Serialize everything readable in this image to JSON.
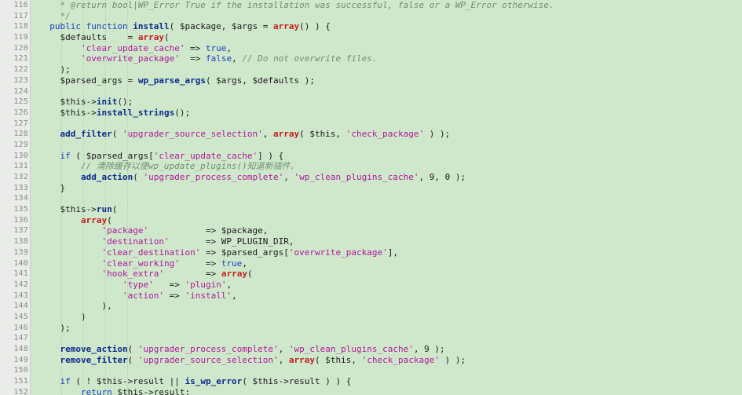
{
  "editor": {
    "colors": {
      "background": "#cfe8cc",
      "gutter": "#e9ece8",
      "keyword": "#1f3fbf",
      "string": "#b0189c",
      "red_keyword": "#c81e1e",
      "comment": "#6f8f6f"
    },
    "lines": [
      {
        "num": "116",
        "indent": "    ",
        "tokens": [
          [
            "comment",
            "* @return bool|WP_Error True if the installation was successful, false or a WP_Error otherwise."
          ]
        ]
      },
      {
        "num": "117",
        "indent": "    ",
        "tokens": [
          [
            "comment",
            "*/"
          ]
        ]
      },
      {
        "num": "118",
        "indent": "  ",
        "tokens": [
          [
            "keyword",
            "public function "
          ],
          [
            "method",
            "install"
          ],
          [
            "punct",
            "( $package, $args = "
          ],
          [
            "red",
            "array"
          ],
          [
            "punct",
            "() ) {"
          ]
        ]
      },
      {
        "num": "119",
        "indent": "    ",
        "tokens": [
          [
            "var",
            "$defaults    = "
          ],
          [
            "red",
            "array"
          ],
          [
            "punct",
            "("
          ]
        ]
      },
      {
        "num": "120",
        "indent": "        ",
        "tokens": [
          [
            "string",
            "'clear_update_cache'"
          ],
          [
            "punct",
            " => "
          ],
          [
            "bool",
            "true"
          ],
          [
            "punct",
            ","
          ]
        ]
      },
      {
        "num": "121",
        "indent": "        ",
        "tokens": [
          [
            "string",
            "'overwrite_package'"
          ],
          [
            "punct",
            "  => "
          ],
          [
            "bool",
            "false"
          ],
          [
            "punct",
            ", "
          ],
          [
            "comment",
            "// Do not overwrite files."
          ]
        ]
      },
      {
        "num": "122",
        "indent": "    ",
        "tokens": [
          [
            "punct",
            ");"
          ]
        ]
      },
      {
        "num": "123",
        "indent": "    ",
        "tokens": [
          [
            "var",
            "$parsed_args = "
          ],
          [
            "method",
            "wp_parse_args"
          ],
          [
            "punct",
            "( $args, $defaults );"
          ]
        ]
      },
      {
        "num": "124",
        "indent": "",
        "tokens": []
      },
      {
        "num": "125",
        "indent": "    ",
        "tokens": [
          [
            "var",
            "$this->"
          ],
          [
            "method",
            "init"
          ],
          [
            "punct",
            "();"
          ]
        ]
      },
      {
        "num": "126",
        "indent": "    ",
        "tokens": [
          [
            "var",
            "$this->"
          ],
          [
            "method",
            "install_strings"
          ],
          [
            "punct",
            "();"
          ]
        ]
      },
      {
        "num": "127",
        "indent": "",
        "tokens": []
      },
      {
        "num": "128",
        "indent": "    ",
        "tokens": [
          [
            "method",
            "add_filter"
          ],
          [
            "punct",
            "( "
          ],
          [
            "string",
            "'upgrader_source_selection'"
          ],
          [
            "punct",
            ", "
          ],
          [
            "red",
            "array"
          ],
          [
            "punct",
            "( $this, "
          ],
          [
            "string",
            "'check_package'"
          ],
          [
            "punct",
            " ) );"
          ]
        ]
      },
      {
        "num": "129",
        "indent": "",
        "tokens": []
      },
      {
        "num": "130",
        "indent": "    ",
        "tokens": [
          [
            "keyword",
            "if"
          ],
          [
            "punct",
            " ( $parsed_args["
          ],
          [
            "string",
            "'clear_update_cache'"
          ],
          [
            "punct",
            "] ) {"
          ]
        ]
      },
      {
        "num": "131",
        "indent": "        ",
        "tokens": [
          [
            "comment",
            "// 清除缓存以便wp_update_plugins()知道新插件."
          ]
        ]
      },
      {
        "num": "132",
        "indent": "        ",
        "tokens": [
          [
            "method",
            "add_action"
          ],
          [
            "punct",
            "( "
          ],
          [
            "string",
            "'upgrader_process_complete'"
          ],
          [
            "punct",
            ", "
          ],
          [
            "string",
            "'wp_clean_plugins_cache'"
          ],
          [
            "punct",
            ", 9, 0 );"
          ]
        ]
      },
      {
        "num": "133",
        "indent": "    ",
        "tokens": [
          [
            "punct",
            "}"
          ]
        ]
      },
      {
        "num": "134",
        "indent": "",
        "tokens": []
      },
      {
        "num": "135",
        "indent": "    ",
        "tokens": [
          [
            "var",
            "$this->"
          ],
          [
            "method",
            "run"
          ],
          [
            "punct",
            "("
          ]
        ]
      },
      {
        "num": "136",
        "indent": "        ",
        "tokens": [
          [
            "red",
            "array"
          ],
          [
            "punct",
            "("
          ]
        ]
      },
      {
        "num": "137",
        "indent": "            ",
        "tokens": [
          [
            "string",
            "'package'"
          ],
          [
            "punct",
            "           => $package,"
          ]
        ]
      },
      {
        "num": "138",
        "indent": "            ",
        "tokens": [
          [
            "string",
            "'destination'"
          ],
          [
            "punct",
            "       => WP_PLUGIN_DIR,"
          ]
        ]
      },
      {
        "num": "139",
        "indent": "            ",
        "tokens": [
          [
            "string",
            "'clear_destination'"
          ],
          [
            "punct",
            " => $parsed_args["
          ],
          [
            "string",
            "'overwrite_package'"
          ],
          [
            "punct",
            "],"
          ]
        ]
      },
      {
        "num": "140",
        "indent": "            ",
        "tokens": [
          [
            "string",
            "'clear_working'"
          ],
          [
            "punct",
            "     => "
          ],
          [
            "bool",
            "true"
          ],
          [
            "punct",
            ","
          ]
        ]
      },
      {
        "num": "141",
        "indent": "            ",
        "tokens": [
          [
            "string",
            "'hook_extra'"
          ],
          [
            "punct",
            "        => "
          ],
          [
            "red",
            "array"
          ],
          [
            "punct",
            "("
          ]
        ]
      },
      {
        "num": "142",
        "indent": "                ",
        "tokens": [
          [
            "string",
            "'type'"
          ],
          [
            "punct",
            "   => "
          ],
          [
            "string",
            "'plugin'"
          ],
          [
            "punct",
            ","
          ]
        ]
      },
      {
        "num": "143",
        "indent": "                ",
        "tokens": [
          [
            "string",
            "'action'"
          ],
          [
            "punct",
            " => "
          ],
          [
            "string",
            "'install'"
          ],
          [
            "punct",
            ","
          ]
        ]
      },
      {
        "num": "144",
        "indent": "            ",
        "tokens": [
          [
            "punct",
            "),"
          ]
        ]
      },
      {
        "num": "145",
        "indent": "        ",
        "tokens": [
          [
            "punct",
            ")"
          ]
        ]
      },
      {
        "num": "146",
        "indent": "    ",
        "tokens": [
          [
            "punct",
            ");"
          ]
        ]
      },
      {
        "num": "147",
        "indent": "",
        "tokens": []
      },
      {
        "num": "148",
        "indent": "    ",
        "tokens": [
          [
            "method",
            "remove_action"
          ],
          [
            "punct",
            "( "
          ],
          [
            "string",
            "'upgrader_process_complete'"
          ],
          [
            "punct",
            ", "
          ],
          [
            "string",
            "'wp_clean_plugins_cache'"
          ],
          [
            "punct",
            ", 9 );"
          ]
        ]
      },
      {
        "num": "149",
        "indent": "    ",
        "tokens": [
          [
            "method",
            "remove_filter"
          ],
          [
            "punct",
            "( "
          ],
          [
            "string",
            "'upgrader_source_selection'"
          ],
          [
            "punct",
            ", "
          ],
          [
            "red",
            "array"
          ],
          [
            "punct",
            "( $this, "
          ],
          [
            "string",
            "'check_package'"
          ],
          [
            "punct",
            " ) );"
          ]
        ]
      },
      {
        "num": "150",
        "indent": "",
        "tokens": []
      },
      {
        "num": "151",
        "indent": "    ",
        "tokens": [
          [
            "keyword",
            "if"
          ],
          [
            "punct",
            " ( ! $this->result || "
          ],
          [
            "method",
            "is_wp_error"
          ],
          [
            "punct",
            "( $this->result ) ) {"
          ]
        ]
      },
      {
        "num": "152",
        "indent": "        ",
        "tokens": [
          [
            "keyword",
            "return"
          ],
          [
            "punct",
            " $this->result;"
          ]
        ]
      }
    ]
  }
}
